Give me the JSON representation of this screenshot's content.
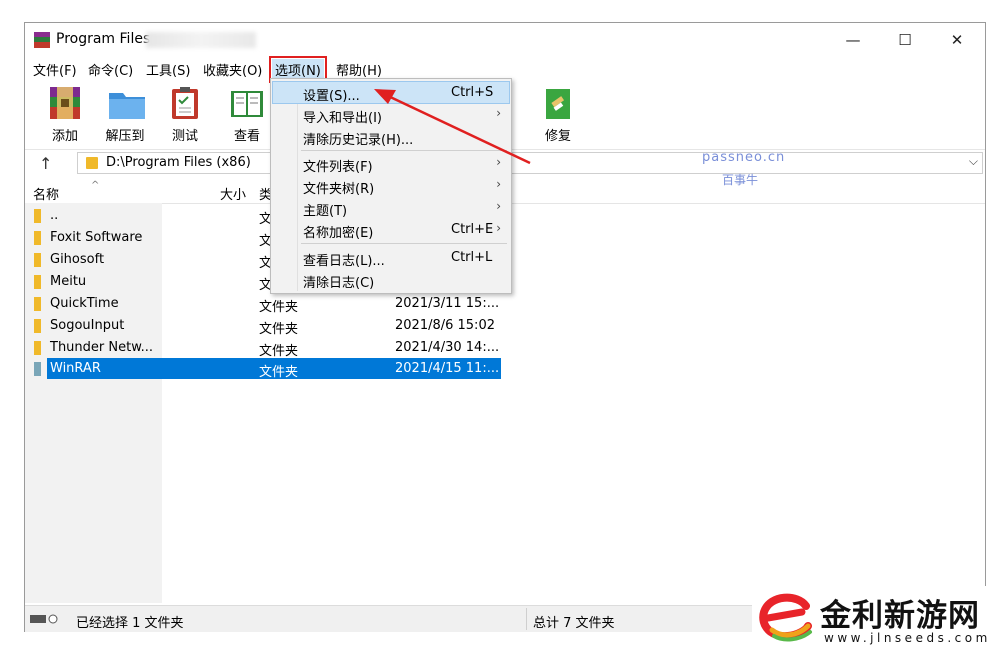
{
  "window": {
    "title": "Program Files",
    "controls": {
      "minimize": "—",
      "maximize": "☐",
      "close": "✕"
    }
  },
  "menubar": {
    "items": [
      "文件(F)",
      "命令(C)",
      "工具(S)",
      "收藏夹(O)",
      "选项(N)",
      "帮助(H)"
    ],
    "active": "选项(N)"
  },
  "toolbar": {
    "buttons": [
      {
        "label": "添加",
        "icon": "winrar-add-icon"
      },
      {
        "label": "解压到",
        "icon": "extract-folder-icon"
      },
      {
        "label": "测试",
        "icon": "test-clipboard-icon"
      },
      {
        "label": "查看",
        "icon": "view-book-icon"
      },
      {
        "label": "修复",
        "icon": "repair-icon"
      }
    ]
  },
  "address": {
    "path": "D:\\Program Files (x86)",
    "dropdown_glyph": "⌵",
    "up_glyph": "↑"
  },
  "columns": {
    "name": "名称",
    "size": "大小",
    "type": "类"
  },
  "files": [
    {
      "name": "..",
      "type": "文",
      "modified": ""
    },
    {
      "name": "Foxit Software",
      "type": "文",
      "modified": ""
    },
    {
      "name": "Gihosoft",
      "type": "文",
      "modified": ""
    },
    {
      "name": "Meitu",
      "type": "文",
      "modified": ""
    },
    {
      "name": "QuickTime",
      "type": "文件夹",
      "modified": "2021/3/11 15:..."
    },
    {
      "name": "SogouInput",
      "type": "文件夹",
      "modified": "2021/8/6 15:02"
    },
    {
      "name": "Thunder Netw...",
      "type": "文件夹",
      "modified": "2021/4/30 14:..."
    },
    {
      "name": "WinRAR",
      "type": "文件夹",
      "modified": "2021/4/15 11:...",
      "selected": true
    }
  ],
  "options_menu": {
    "items": [
      {
        "label": "设置(S)...",
        "shortcut": "Ctrl+S",
        "arrow": false,
        "highlighted": true
      },
      {
        "label": "导入和导出(I)",
        "shortcut": "",
        "arrow": true
      },
      {
        "label": "清除历史记录(H)...",
        "shortcut": "",
        "arrow": false
      },
      {
        "label": "文件列表(F)",
        "shortcut": "",
        "arrow": true
      },
      {
        "label": "文件夹树(R)",
        "shortcut": "",
        "arrow": true
      },
      {
        "label": "主题(T)",
        "shortcut": "",
        "arrow": true
      },
      {
        "label": "名称加密(E)",
        "shortcut": "Ctrl+E",
        "arrow": true
      },
      {
        "label": "查看日志(L)...",
        "shortcut": "Ctrl+L",
        "arrow": false
      },
      {
        "label": "清除日志(C)",
        "shortcut": "",
        "arrow": false
      }
    ]
  },
  "status": {
    "left": "已经选择 1 文件夹",
    "right": "总计 7 文件夹"
  },
  "watermark": {
    "line1": "passneo.cn",
    "line2": "百事牛"
  },
  "logo": {
    "main": "金利新游网",
    "sub": "www.jlnseeds.com"
  },
  "colors": {
    "selection": "#0078d7",
    "menu_highlight": "#cce4f7",
    "annotation_red": "#e02020",
    "folder": "#f0b92a"
  }
}
